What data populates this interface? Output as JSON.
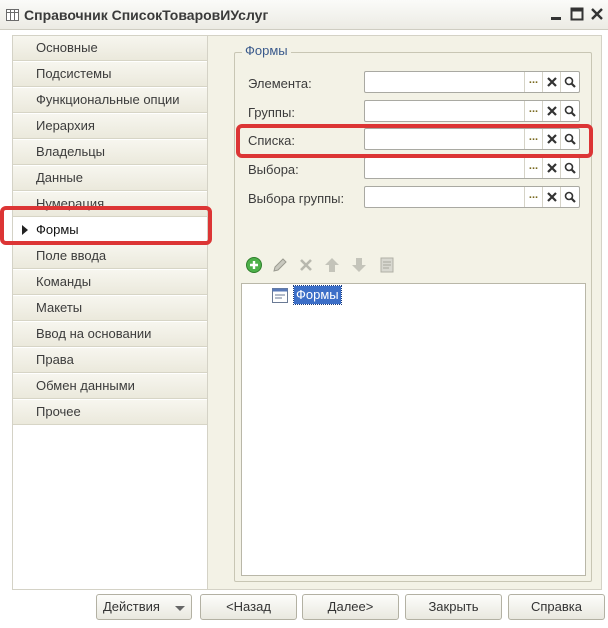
{
  "window": {
    "title": "Справочник СписокТоваровИУслуг"
  },
  "nav": {
    "items": [
      {
        "label": "Основные"
      },
      {
        "label": "Подсистемы"
      },
      {
        "label": "Функциональные опции"
      },
      {
        "label": "Иерархия"
      },
      {
        "label": "Владельцы"
      },
      {
        "label": "Данные"
      },
      {
        "label": "Нумерация"
      },
      {
        "label": "Формы"
      },
      {
        "label": "Поле ввода"
      },
      {
        "label": "Команды"
      },
      {
        "label": "Макеты"
      },
      {
        "label": "Ввод на основании"
      },
      {
        "label": "Права"
      },
      {
        "label": "Обмен данными"
      },
      {
        "label": "Прочее"
      }
    ],
    "active": "Формы"
  },
  "forms": {
    "group_title": "Формы",
    "fields": [
      {
        "label": "Элемента:",
        "value": ""
      },
      {
        "label": "Группы:",
        "value": ""
      },
      {
        "label": "Списка:",
        "value": ""
      },
      {
        "label": "Выбора:",
        "value": ""
      },
      {
        "label": "Выбора группы:",
        "value": ""
      }
    ],
    "field_buttons": {
      "select": "...",
      "clear": "✕"
    },
    "tree": {
      "items": [
        {
          "label": "Формы",
          "selected": true
        }
      ]
    }
  },
  "buttons": {
    "actions": "Действия",
    "back": "<Назад",
    "next": "Далее>",
    "close": "Закрыть",
    "help": "Справка"
  },
  "colors": {
    "accent": "#3c6fc8",
    "highlight": "#dc3535",
    "panel": "#f3f2e6",
    "group_title": "#3a5a8c"
  },
  "icons": {
    "toolbar": [
      "add-icon",
      "edit-icon",
      "delete-icon",
      "move-up-icon",
      "move-down-icon",
      "list-icon"
    ]
  }
}
